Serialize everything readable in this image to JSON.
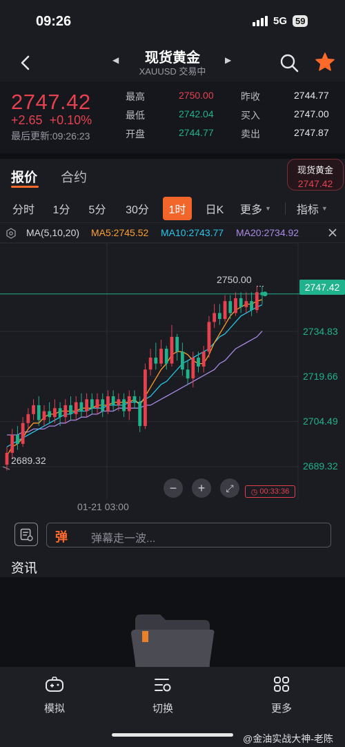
{
  "status": {
    "time": "09:26",
    "network": "5G",
    "battery": "59"
  },
  "nav": {
    "title": "现货黄金",
    "subtitle": "XAUUSD 交易中"
  },
  "quote": {
    "price": "2747.42",
    "change": "+2.65",
    "change_pct": "+0.10%",
    "updated": "最后更新:09:26:23",
    "high_label": "最高",
    "high": "2750.00",
    "low_label": "最低",
    "low": "2742.04",
    "open_label": "开盘",
    "open": "2744.77",
    "prev_close_label": "昨收",
    "prev_close": "2744.77",
    "bid_label": "买入",
    "bid": "2747.00",
    "ask_label": "卖出",
    "ask": "2747.87"
  },
  "tabs": {
    "active": "报价",
    "other": "合约"
  },
  "chip": {
    "name": "现货黄金",
    "price": "2747.42"
  },
  "periods": [
    "分时",
    "1分",
    "5分",
    "30分",
    "1时",
    "日K",
    "更多"
  ],
  "active_period": "1时",
  "indicator_label": "指标",
  "ma": {
    "label": "MA(5,10,20)",
    "ma5": "MA5:2745.52",
    "ma10": "MA10:2743.77",
    "ma20": "MA20:2734.92",
    "ma5_color": "#ff9f2b",
    "ma10_color": "#27c6e8",
    "ma20_color": "#a98ae6"
  },
  "chart_data": {
    "type": "candlestick",
    "y_ticks": [
      "2734.83",
      "2719.66",
      "2704.49",
      "2689.32"
    ],
    "last_price_label": "2747.42",
    "high_marker": "2750.00",
    "low_marker": "2689.32",
    "x_label": "01-21 03:00",
    "ylim": [
      2684,
      2762
    ],
    "candles": [
      [
        2690,
        2694,
        2688,
        2696
      ],
      [
        2694,
        2700,
        2692,
        2702
      ],
      [
        2700,
        2697,
        2695,
        2703
      ],
      [
        2697,
        2704,
        2696,
        2706
      ],
      [
        2704,
        2707,
        2702,
        2709
      ],
      [
        2707,
        2710,
        2705,
        2712
      ],
      [
        2710,
        2705,
        2703,
        2713
      ],
      [
        2705,
        2708,
        2703,
        2710
      ],
      [
        2708,
        2706,
        2704,
        2711
      ],
      [
        2706,
        2709,
        2704,
        2712
      ],
      [
        2709,
        2706,
        2703,
        2711
      ],
      [
        2706,
        2710,
        2704,
        2712
      ],
      [
        2710,
        2707,
        2705,
        2713
      ],
      [
        2707,
        2711,
        2705,
        2713
      ],
      [
        2711,
        2708,
        2706,
        2714
      ],
      [
        2708,
        2712,
        2706,
        2714
      ],
      [
        2712,
        2709,
        2707,
        2714
      ],
      [
        2709,
        2712,
        2707,
        2714
      ],
      [
        2712,
        2708,
        2706,
        2714
      ],
      [
        2708,
        2713,
        2707,
        2715
      ],
      [
        2713,
        2710,
        2708,
        2715
      ],
      [
        2710,
        2712,
        2708,
        2714
      ],
      [
        2712,
        2708,
        2706,
        2714
      ],
      [
        2708,
        2713,
        2705,
        2715
      ],
      [
        2713,
        2711,
        2709,
        2715
      ],
      [
        2711,
        2703,
        2701,
        2713
      ],
      [
        2703,
        2722,
        2702,
        2724
      ],
      [
        2722,
        2726,
        2720,
        2729
      ],
      [
        2726,
        2724,
        2722,
        2731
      ],
      [
        2724,
        2729,
        2723,
        2732
      ],
      [
        2729,
        2724,
        2722,
        2730
      ],
      [
        2724,
        2733,
        2723,
        2737
      ],
      [
        2733,
        2728,
        2725,
        2734
      ],
      [
        2728,
        2722,
        2720,
        2731
      ],
      [
        2722,
        2719,
        2717,
        2725
      ],
      [
        2719,
        2726,
        2716,
        2728
      ],
      [
        2726,
        2723,
        2721,
        2728
      ],
      [
        2723,
        2728,
        2721,
        2730
      ],
      [
        2728,
        2738,
        2726,
        2740
      ],
      [
        2738,
        2741,
        2736,
        2744
      ],
      [
        2741,
        2739,
        2737,
        2744
      ],
      [
        2739,
        2745,
        2738,
        2747
      ],
      [
        2745,
        2741,
        2739,
        2747
      ],
      [
        2741,
        2746,
        2740,
        2748
      ],
      [
        2746,
        2743,
        2741,
        2748
      ],
      [
        2743,
        2745,
        2741,
        2748
      ],
      [
        2745,
        2742,
        2740,
        2748
      ],
      [
        2742,
        2748,
        2741,
        2750
      ],
      [
        2748,
        2747,
        2744,
        2750
      ]
    ],
    "ma5": [
      2693,
      2696,
      2697,
      2699,
      2702,
      2704,
      2704,
      2706,
      2707,
      2707,
      2708,
      2708,
      2708,
      2708,
      2709,
      2709,
      2709,
      2710,
      2710,
      2710,
      2711,
      2711,
      2711,
      2711,
      2712,
      2710,
      2713,
      2716,
      2719,
      2722,
      2724,
      2727,
      2728,
      2728,
      2727,
      2725,
      2724,
      2724,
      2727,
      2731,
      2734,
      2737,
      2740,
      2742,
      2743,
      2744,
      2744,
      2745,
      2745.52
    ],
    "ma10": [
      2696,
      2697,
      2698,
      2699,
      2700,
      2701,
      2702,
      2703,
      2704,
      2705,
      2706,
      2707,
      2707,
      2708,
      2708,
      2708,
      2709,
      2709,
      2709,
      2710,
      2710,
      2710,
      2710,
      2711,
      2711,
      2711,
      2712,
      2713,
      2715,
      2717,
      2718,
      2720,
      2722,
      2724,
      2725,
      2726,
      2727,
      2728,
      2729,
      2731,
      2733,
      2734,
      2736,
      2738,
      2740,
      2741,
      2742,
      2743,
      2743.77
    ],
    "ma20": [
      2700,
      2700,
      2700,
      2701,
      2701,
      2702,
      2702,
      2702,
      2703,
      2703,
      2704,
      2704,
      2705,
      2705,
      2706,
      2706,
      2707,
      2707,
      2708,
      2708,
      2708,
      2709,
      2709,
      2709,
      2709,
      2709,
      2710,
      2710,
      2711,
      2712,
      2713,
      2714,
      2715,
      2716,
      2717,
      2718,
      2719,
      2720,
      2721,
      2722,
      2724,
      2725,
      2727,
      2729,
      2730,
      2731,
      2732,
      2733,
      2734.92
    ]
  },
  "chart_controls": {
    "timer": "00:33:36"
  },
  "danmu": {
    "badge": "弹",
    "placeholder": "弹幕走一波..."
  },
  "news": {
    "title": "资讯"
  },
  "bottom_nav": {
    "simulate": "模拟",
    "switch": "切换",
    "more": "更多"
  },
  "watermark": "@金油实战大神-老陈",
  "colors": {
    "up": "#e5414f",
    "down": "#20b28c",
    "accent": "#f2652b"
  }
}
